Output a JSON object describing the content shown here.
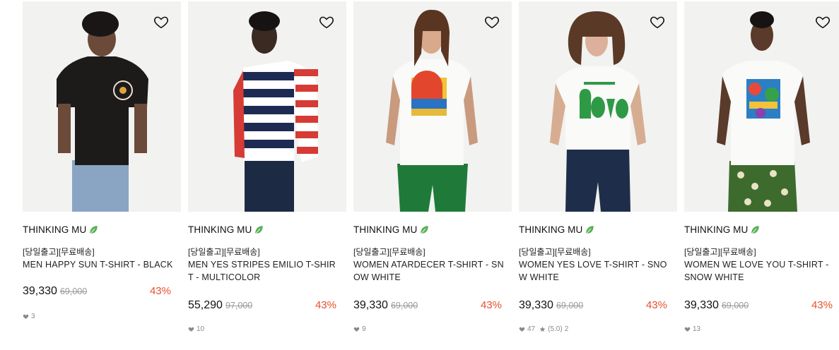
{
  "accent_color": "#e8512d",
  "leaf_color": "#5cb85c",
  "products": [
    {
      "brand": "THINKING MU",
      "tag": "[당일출고][무료배송]",
      "title": "MEN HAPPY SUN T-SHIRT - BLACK",
      "price": "39,330",
      "original_price": "69,000",
      "discount": "43%",
      "likes": "3",
      "rating": "",
      "reviews": ""
    },
    {
      "brand": "THINKING MU",
      "tag": "[당일출고][무료배송]",
      "title": "MEN YES STRIPES EMILIO T-SHIRT - MULTICOLOR",
      "price": "55,290",
      "original_price": "97,000",
      "discount": "43%",
      "likes": "10",
      "rating": "",
      "reviews": ""
    },
    {
      "brand": "THINKING MU",
      "tag": "[당일출고][무료배송]",
      "title": "WOMEN ATARDECER T-SHIRT - SNOW WHITE",
      "price": "39,330",
      "original_price": "69,000",
      "discount": "43%",
      "likes": "9",
      "rating": "",
      "reviews": ""
    },
    {
      "brand": "THINKING MU",
      "tag": "[당일출고][무료배송]",
      "title": "WOMEN YES LOVE T-SHIRT - SNOW WHITE",
      "price": "39,330",
      "original_price": "69,000",
      "discount": "43%",
      "likes": "47",
      "rating": "(5.0)",
      "reviews": "2"
    },
    {
      "brand": "THINKING MU",
      "tag": "[당일출고][무료배송]",
      "title": "WOMEN WE LOVE YOU T-SHIRT - SNOW WHITE",
      "price": "39,330",
      "original_price": "69,000",
      "discount": "43%",
      "likes": "13",
      "rating": "",
      "reviews": ""
    }
  ]
}
